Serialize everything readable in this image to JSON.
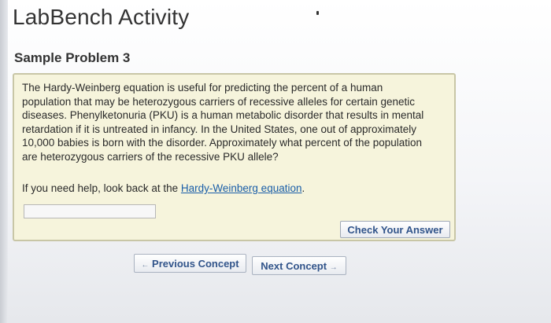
{
  "app": {
    "title": "LabBench Activity"
  },
  "problem": {
    "title": "Sample Problem 3",
    "lines": [
      "The Hardy-Weinberg equation is useful for predicting the percent of a human",
      "population that may be heterozygous carriers of recessive alleles for certain genetic",
      "diseases. Phenylketonuria (PKU) is a human metabolic disorder that results in mental",
      "retardation if it is untreated in infancy. In the United States, one out of approximately",
      "10,000 babies is born with the disorder. Approximately what percent of the population",
      "are heterozygous carriers of the recessive PKU allele?"
    ],
    "help_prefix": "If you need help, look back at the ",
    "help_link": "Hardy-Weinberg equation",
    "help_suffix": ".",
    "answer_value": "",
    "check_label": "Check Your Answer"
  },
  "navigation": {
    "prev_arrow": "←",
    "prev_label": "Previous Concept",
    "next_label": "Next Concept",
    "next_arrow": "→"
  },
  "colors": {
    "box_background": "#f6f4dc",
    "button_text": "#31548a",
    "link": "#1a5ea8"
  }
}
